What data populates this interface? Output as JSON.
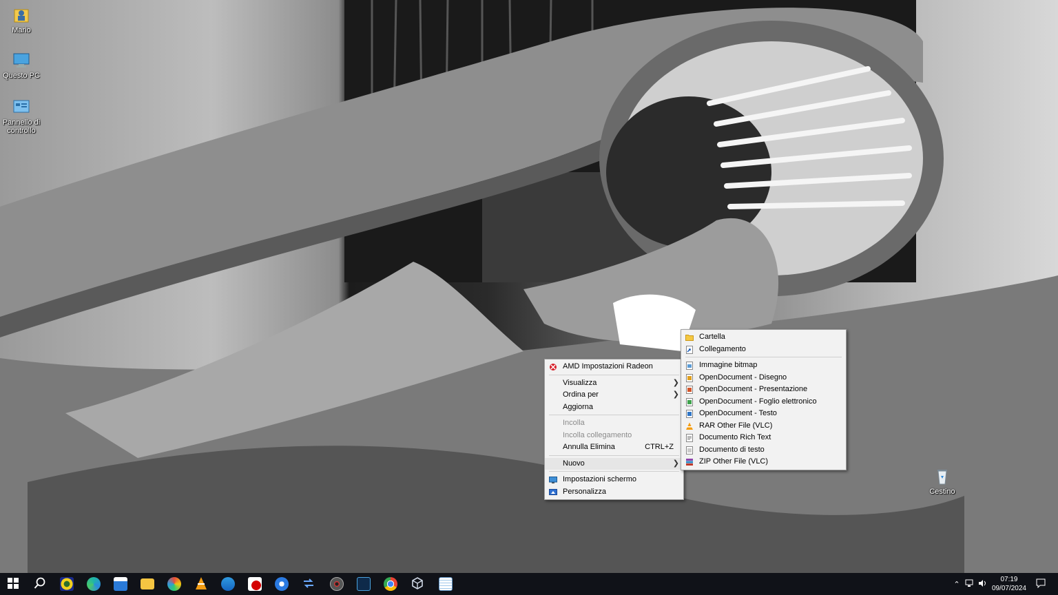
{
  "desktop": {
    "icons": [
      {
        "label": "Mario",
        "icon": "user-folder-icon"
      },
      {
        "label": "Questo PC",
        "icon": "computer-icon"
      },
      {
        "label": "Pannello di controllo",
        "icon": "control-panel-icon"
      },
      {
        "label": "Cestino",
        "icon": "recycle-bin-icon"
      }
    ]
  },
  "context_menu": {
    "items": [
      {
        "label": "AMD Impostazioni Radeon",
        "icon": "amd-radeon-icon"
      },
      {
        "label": "Visualizza",
        "submenu": true
      },
      {
        "label": "Ordina per",
        "submenu": true
      },
      {
        "label": "Aggiorna"
      },
      {
        "label": "Incolla",
        "disabled": true
      },
      {
        "label": "Incolla collegamento",
        "disabled": true
      },
      {
        "label": "Annulla Elimina",
        "shortcut": "CTRL+Z"
      },
      {
        "label": "Nuovo",
        "submenu": true,
        "highlighted": true
      },
      {
        "label": "Impostazioni schermo",
        "icon": "display-settings-icon"
      },
      {
        "label": "Personalizza",
        "icon": "personalize-icon"
      }
    ]
  },
  "submenu_nuovo": {
    "items": [
      {
        "label": "Cartella",
        "icon": "folder-icon"
      },
      {
        "label": "Collegamento",
        "icon": "shortcut-icon"
      },
      {
        "label": "Immagine bitmap",
        "icon": "bitmap-icon"
      },
      {
        "label": "OpenDocument - Disegno",
        "icon": "odg-icon"
      },
      {
        "label": "OpenDocument - Presentazione",
        "icon": "odp-icon"
      },
      {
        "label": "OpenDocument - Foglio elettronico",
        "icon": "ods-icon"
      },
      {
        "label": "OpenDocument - Testo",
        "icon": "odt-icon"
      },
      {
        "label": "RAR Other File (VLC)",
        "icon": "vlc-icon"
      },
      {
        "label": "Documento Rich Text",
        "icon": "rtf-icon"
      },
      {
        "label": "Documento di testo",
        "icon": "txt-icon"
      },
      {
        "label": "ZIP Other File (VLC)",
        "icon": "zip-icon"
      }
    ]
  },
  "taskbar": {
    "pinned": [
      "start-icon",
      "search-icon",
      "app-eye-icon",
      "edge-icon",
      "store-icon",
      "file-explorer-icon",
      "paint-icon",
      "vlc-icon",
      "thunderbird-icon",
      "app-red-icon",
      "firefox-icon",
      "remote-icon",
      "disk-icon",
      "terminal-icon",
      "chrome-icon",
      "virtualbox-icon",
      "notepad-icon"
    ],
    "clock": {
      "time": "07:19",
      "date": "09/07/2024"
    }
  },
  "colors": {
    "menu_bg": "#f2f2f2",
    "menu_highlight": "#e6e6e6",
    "taskbar_bg": "#101218",
    "disabled_text": "#8a8a8a"
  }
}
